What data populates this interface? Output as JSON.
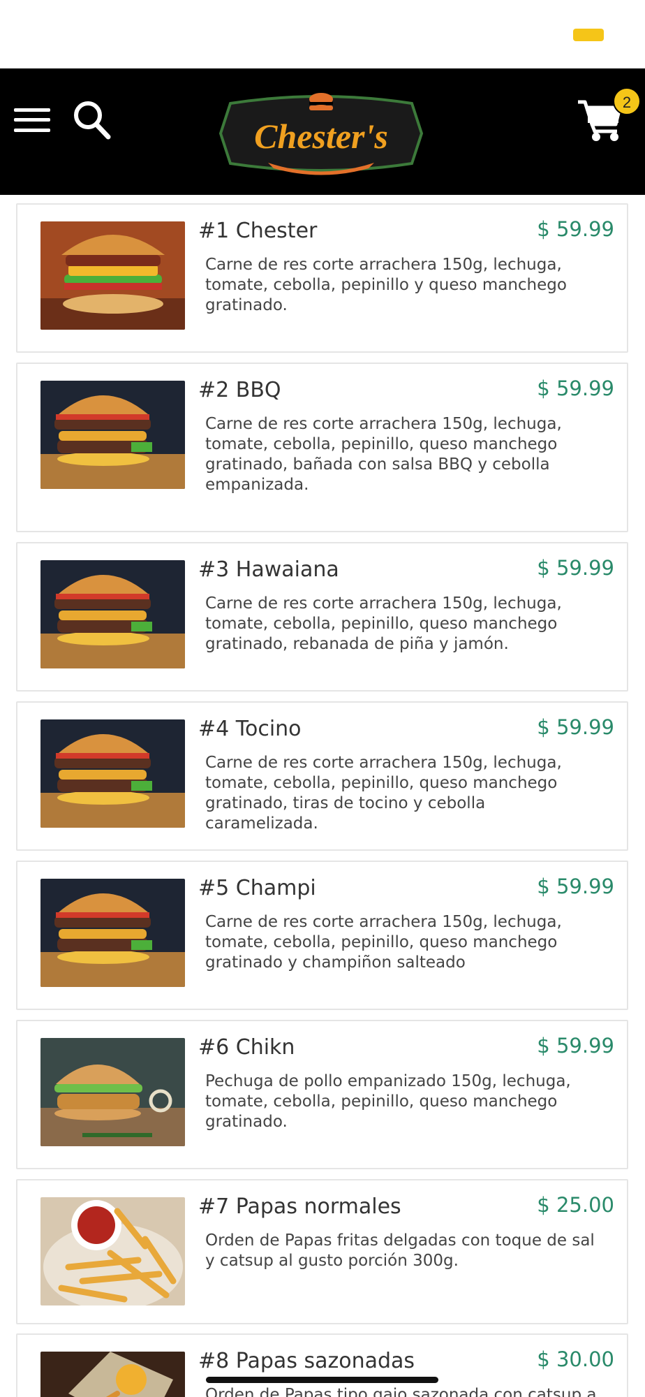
{
  "colors": {
    "accent_yellow": "#f5c518",
    "header_bg": "#000000",
    "price_green": "#2a8a6a",
    "logo_orange": "#f0a020",
    "logo_green": "#3c7a3a",
    "home_indicator": "#111111"
  },
  "header": {
    "menu_icon": "hamburger-menu-icon",
    "search_icon": "search-icon",
    "logo_text": "Chester's",
    "cart_icon": "shopping-cart-icon",
    "cart_count": "2"
  },
  "menu": [
    {
      "title": "#1 Chester",
      "price": "$ 59.99",
      "description": "Carne de res corte arrachera 150g, lechuga, tomate, cebolla, pepinillo y queso manchego gratinado.",
      "image": "burger-bacon-photo"
    },
    {
      "title": "#2 BBQ",
      "price": "$ 59.99",
      "description": "Carne de res corte arrachera 150g, lechuga, tomate, cebolla, pepinillo, queso manchego gratinado, bañada con salsa BBQ y cebolla empanizada.",
      "image": "burger-classic-photo"
    },
    {
      "title": "#3 Hawaiana",
      "price": "$ 59.99",
      "description": "Carne de res corte arrachera 150g, lechuga, tomate, cebolla, pepinillo, queso manchego gratinado, rebanada de piña y jamón.",
      "image": "burger-classic-photo"
    },
    {
      "title": "#4 Tocino",
      "price": "$ 59.99",
      "description": "Carne de res corte arrachera 150g, lechuga, tomate, cebolla, pepinillo, queso manchego gratinado, tiras de tocino y cebolla caramelizada.",
      "image": "burger-classic-photo"
    },
    {
      "title": "#5 Champi",
      "price": "$ 59.99",
      "description": "Carne de res corte arrachera 150g, lechuga, tomate, cebolla, pepinillo, queso manchego gratinado y champiñon salteado",
      "image": "burger-classic-photo"
    },
    {
      "title": "#6 Chikn",
      "price": "$ 59.99",
      "description": "Pechuga de pollo empanizado 150g, lechuga, tomate, cebolla, pepinillo, queso manchego gratinado.",
      "image": "chicken-burger-photo"
    },
    {
      "title": "#7 Papas normales",
      "price": "$ 25.00",
      "description": "Orden de Papas fritas delgadas con toque de sal y catsup al gusto porción 300g.",
      "image": "fries-photo"
    },
    {
      "title": "#8 Papas sazonadas",
      "price": "$ 30.00",
      "description": "Orden de Papas tipo gajo sazonada con catsup al",
      "image": "seasoned-fries-photo"
    }
  ]
}
